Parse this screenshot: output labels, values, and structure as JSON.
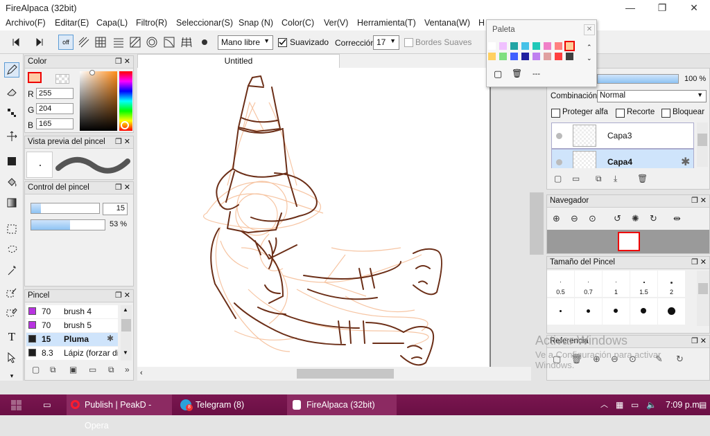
{
  "window": {
    "title": "FireAlpaca (32bit)",
    "minimize": "—",
    "restore": "❐",
    "close": "✕"
  },
  "menu": [
    "Archivo(F)",
    "Editar(E)",
    "Capa(L)",
    "Filtro(R)",
    "Seleccionar(S)",
    "Snap (N)",
    "Color(C)",
    "Ver(V)",
    "Herramienta(T)",
    "Ventana(W)",
    "H"
  ],
  "toolbar": {
    "snap_off": "off",
    "brush_mode": "Mano libre",
    "smoothing_label": "Suavizado",
    "correction_label": "Corrección",
    "correction_value": "17",
    "soft_edges_label": "Bordes Suaves"
  },
  "color_panel": {
    "title": "Color",
    "r_label": "R",
    "g_label": "G",
    "b_label": "B",
    "r": "255",
    "g": "204",
    "b": "165",
    "current_color": "#ffcca5"
  },
  "brush_preview": {
    "title": "Vista previa del pincel"
  },
  "brush_control": {
    "title": "Control del pincel",
    "size": "15",
    "opacity": "53 %",
    "size_fraction": 0.14,
    "opacity_fraction": 0.53
  },
  "brush_list": {
    "title": "Pincel",
    "items": [
      {
        "size": "70",
        "name": "brush 4",
        "color": "#b833e0"
      },
      {
        "size": "70",
        "name": "brush 5",
        "color": "#b833e0"
      },
      {
        "size": "15",
        "name": "Pluma",
        "color": "#222222"
      },
      {
        "size": "8.3",
        "name": "Lápiz (forzar di",
        "color": "#222222"
      }
    ]
  },
  "canvas": {
    "tab": "Untitled"
  },
  "palette": {
    "title": "Paleta",
    "value": "---"
  },
  "layers": {
    "opacity": "100 %",
    "blend_label": "Combinación",
    "blend_value": "Normal",
    "protect_alpha": "Proteger alfa",
    "clip": "Recorte",
    "lock": "Bloquear",
    "items": [
      {
        "name": "Capa3"
      },
      {
        "name": "Capa4"
      }
    ]
  },
  "navigator": {
    "title": "Navegador"
  },
  "brush_size": {
    "title": "Tamaño del Pincel",
    "sizes": [
      "0.5",
      "0.7",
      "1",
      "1.5",
      "2"
    ]
  },
  "reference": {
    "title": "Referencia"
  },
  "watermark": {
    "line1": "Activar Windows",
    "line2": "Ve a Configuración para activar",
    "line3": "Windows."
  },
  "taskbar": {
    "opera": "Publish | PeakD - Opera",
    "telegram": "Telegram (8)",
    "firealpaca": "FireAlpaca (32bit)",
    "time": "7:09 p.m.",
    "telegram_badge": "8"
  }
}
